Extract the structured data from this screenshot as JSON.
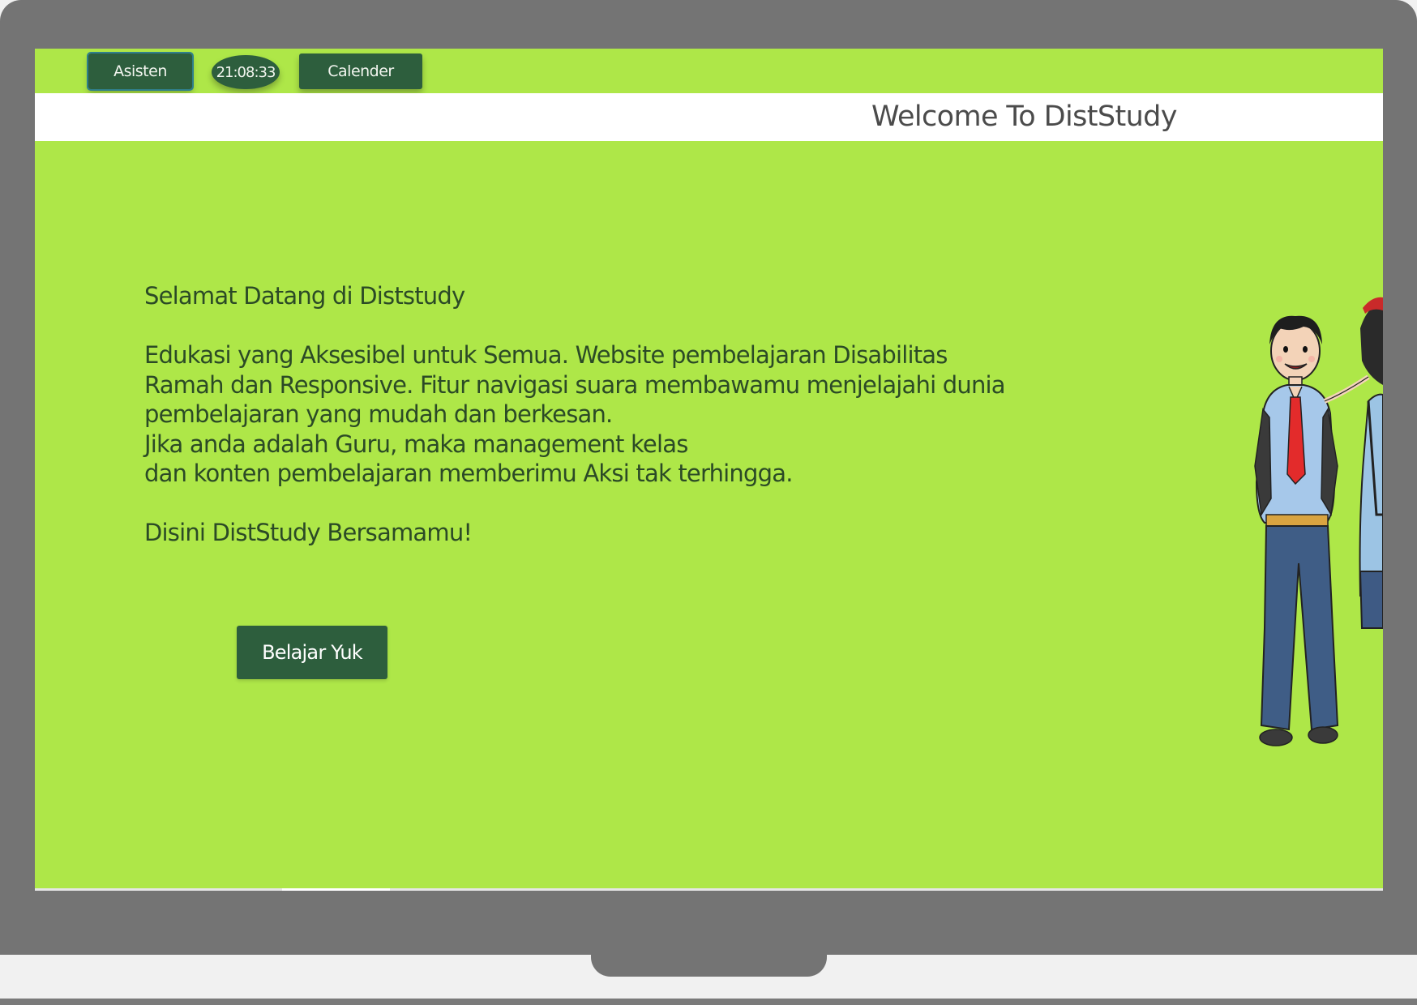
{
  "topbar": {
    "assistant_label": "Asisten",
    "clock": "21:08:33",
    "calendar_label": "Calender"
  },
  "header": {
    "welcome": "Welcome To DistStudy"
  },
  "hero": {
    "intro": "Selamat Datang di Diststudy\n\nEdukasi yang Aksesibel untuk Semua. Website pembelajaran Disabilitas\nRamah dan Responsive. Fitur navigasi suara membawamu menjelajahi dunia\npembelajaran yang mudah dan berkesan.\nJika anda adalah Guru, maka management kelas\ndan konten pembelajaran memberimu Aksi tak terhingga.\n\nDisini DistStudy Bersamamu!",
    "cta_label": "Belajar Yuk"
  },
  "colors": {
    "page_background": "#aee748",
    "button_background": "#2d5e3d",
    "device_frame": "#747474"
  },
  "icons": {
    "illustration": "students-illustration"
  }
}
